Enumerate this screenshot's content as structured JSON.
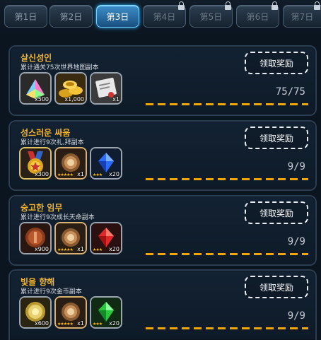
{
  "tabs": [
    {
      "label": "第1日",
      "state": "normal"
    },
    {
      "label": "第2日",
      "state": "normal"
    },
    {
      "label": "第3日",
      "state": "active"
    },
    {
      "label": "第4日",
      "state": "locked"
    },
    {
      "label": "第5日",
      "state": "locked"
    },
    {
      "label": "第6日",
      "state": "locked"
    },
    {
      "label": "第7日",
      "state": "locked"
    }
  ],
  "quests": [
    {
      "title": "살신성인",
      "desc": "累计通关75次世界地图副本",
      "button": "领取奖励",
      "progress": "75/75",
      "progress_fraction": 1.0,
      "rewards": [
        {
          "icon": "crystal-chest-icon",
          "qty": "x500",
          "stars": ""
        },
        {
          "icon": "gold-coins-icon",
          "qty": "x1,000",
          "stars": ""
        },
        {
          "icon": "scroll-icon",
          "qty": "x1",
          "stars": ""
        }
      ]
    },
    {
      "title": "성스러운 싸움",
      "desc": "累计进行9次礼,拜副本",
      "button": "领取奖励",
      "progress": "9/9",
      "progress_fraction": 1.0,
      "rewards": [
        {
          "icon": "medal-icon",
          "qty": "x300",
          "stars": ""
        },
        {
          "icon": "bronze-gem-icon",
          "qty": "x1",
          "stars": "★★★★★"
        },
        {
          "icon": "blue-crystal-icon",
          "qty": "x20",
          "stars": "★★★"
        }
      ]
    },
    {
      "title": "숭고한 임무",
      "desc": "累计进行9次成长天命副本",
      "button": "领取奖励",
      "progress": "9/9",
      "progress_fraction": 1.0,
      "rewards": [
        {
          "icon": "copper-coin-icon",
          "qty": "x900",
          "stars": ""
        },
        {
          "icon": "bronze-gem-icon",
          "qty": "x1",
          "stars": "★★★★★"
        },
        {
          "icon": "red-crystal-icon",
          "qty": "x20",
          "stars": "★★★"
        }
      ]
    },
    {
      "title": "빛을 향해",
      "desc": "累计进行9次金币副本",
      "button": "领取奖励",
      "progress": "9/9",
      "progress_fraction": 1.0,
      "rewards": [
        {
          "icon": "gold-coin-icon",
          "qty": "x600",
          "stars": ""
        },
        {
          "icon": "bronze-gem-icon",
          "qty": "x1",
          "stars": "★★★★★"
        },
        {
          "icon": "green-crystal-icon",
          "qty": "x20",
          "stars": "★★★"
        }
      ]
    }
  ]
}
